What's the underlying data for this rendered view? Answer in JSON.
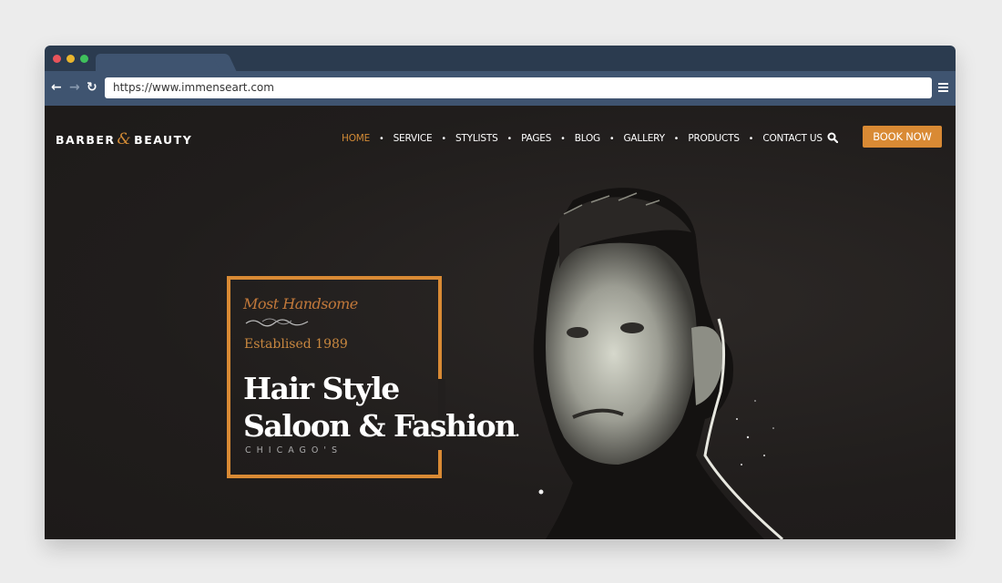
{
  "browser": {
    "url": "https://www.immenseart.com",
    "window_controls": [
      "close",
      "minimize",
      "maximize"
    ],
    "nav_icons": [
      "back-arrow-icon",
      "forward-arrow-icon",
      "reload-icon"
    ],
    "menu_icon": "hamburger-menu-icon"
  },
  "site": {
    "logo": {
      "part1": "BARBER",
      "amp": "&",
      "part2": "BEAUTY"
    },
    "nav": [
      {
        "label": "HOME",
        "active": true
      },
      {
        "label": "SERVICE",
        "active": false
      },
      {
        "label": "STYLISTS",
        "active": false
      },
      {
        "label": "PAGES",
        "active": false
      },
      {
        "label": "BLOG",
        "active": false
      },
      {
        "label": "GALLERY",
        "active": false
      },
      {
        "label": "PRODUCTS",
        "active": false
      },
      {
        "label": "CONTACT US",
        "active": false
      }
    ],
    "nav_separator": "•",
    "search_icon": "search-icon",
    "book_button": "BOOK NOW",
    "accent_color": "#d98a34"
  },
  "hero": {
    "script_title": "Most Handsome",
    "established": "Establised 1989",
    "headline_line1": "Hair Style",
    "headline_line2": "Saloon & Fashion",
    "headline_period": ".",
    "city": "CHICAGO'S",
    "image": "man-portrait-photo"
  }
}
